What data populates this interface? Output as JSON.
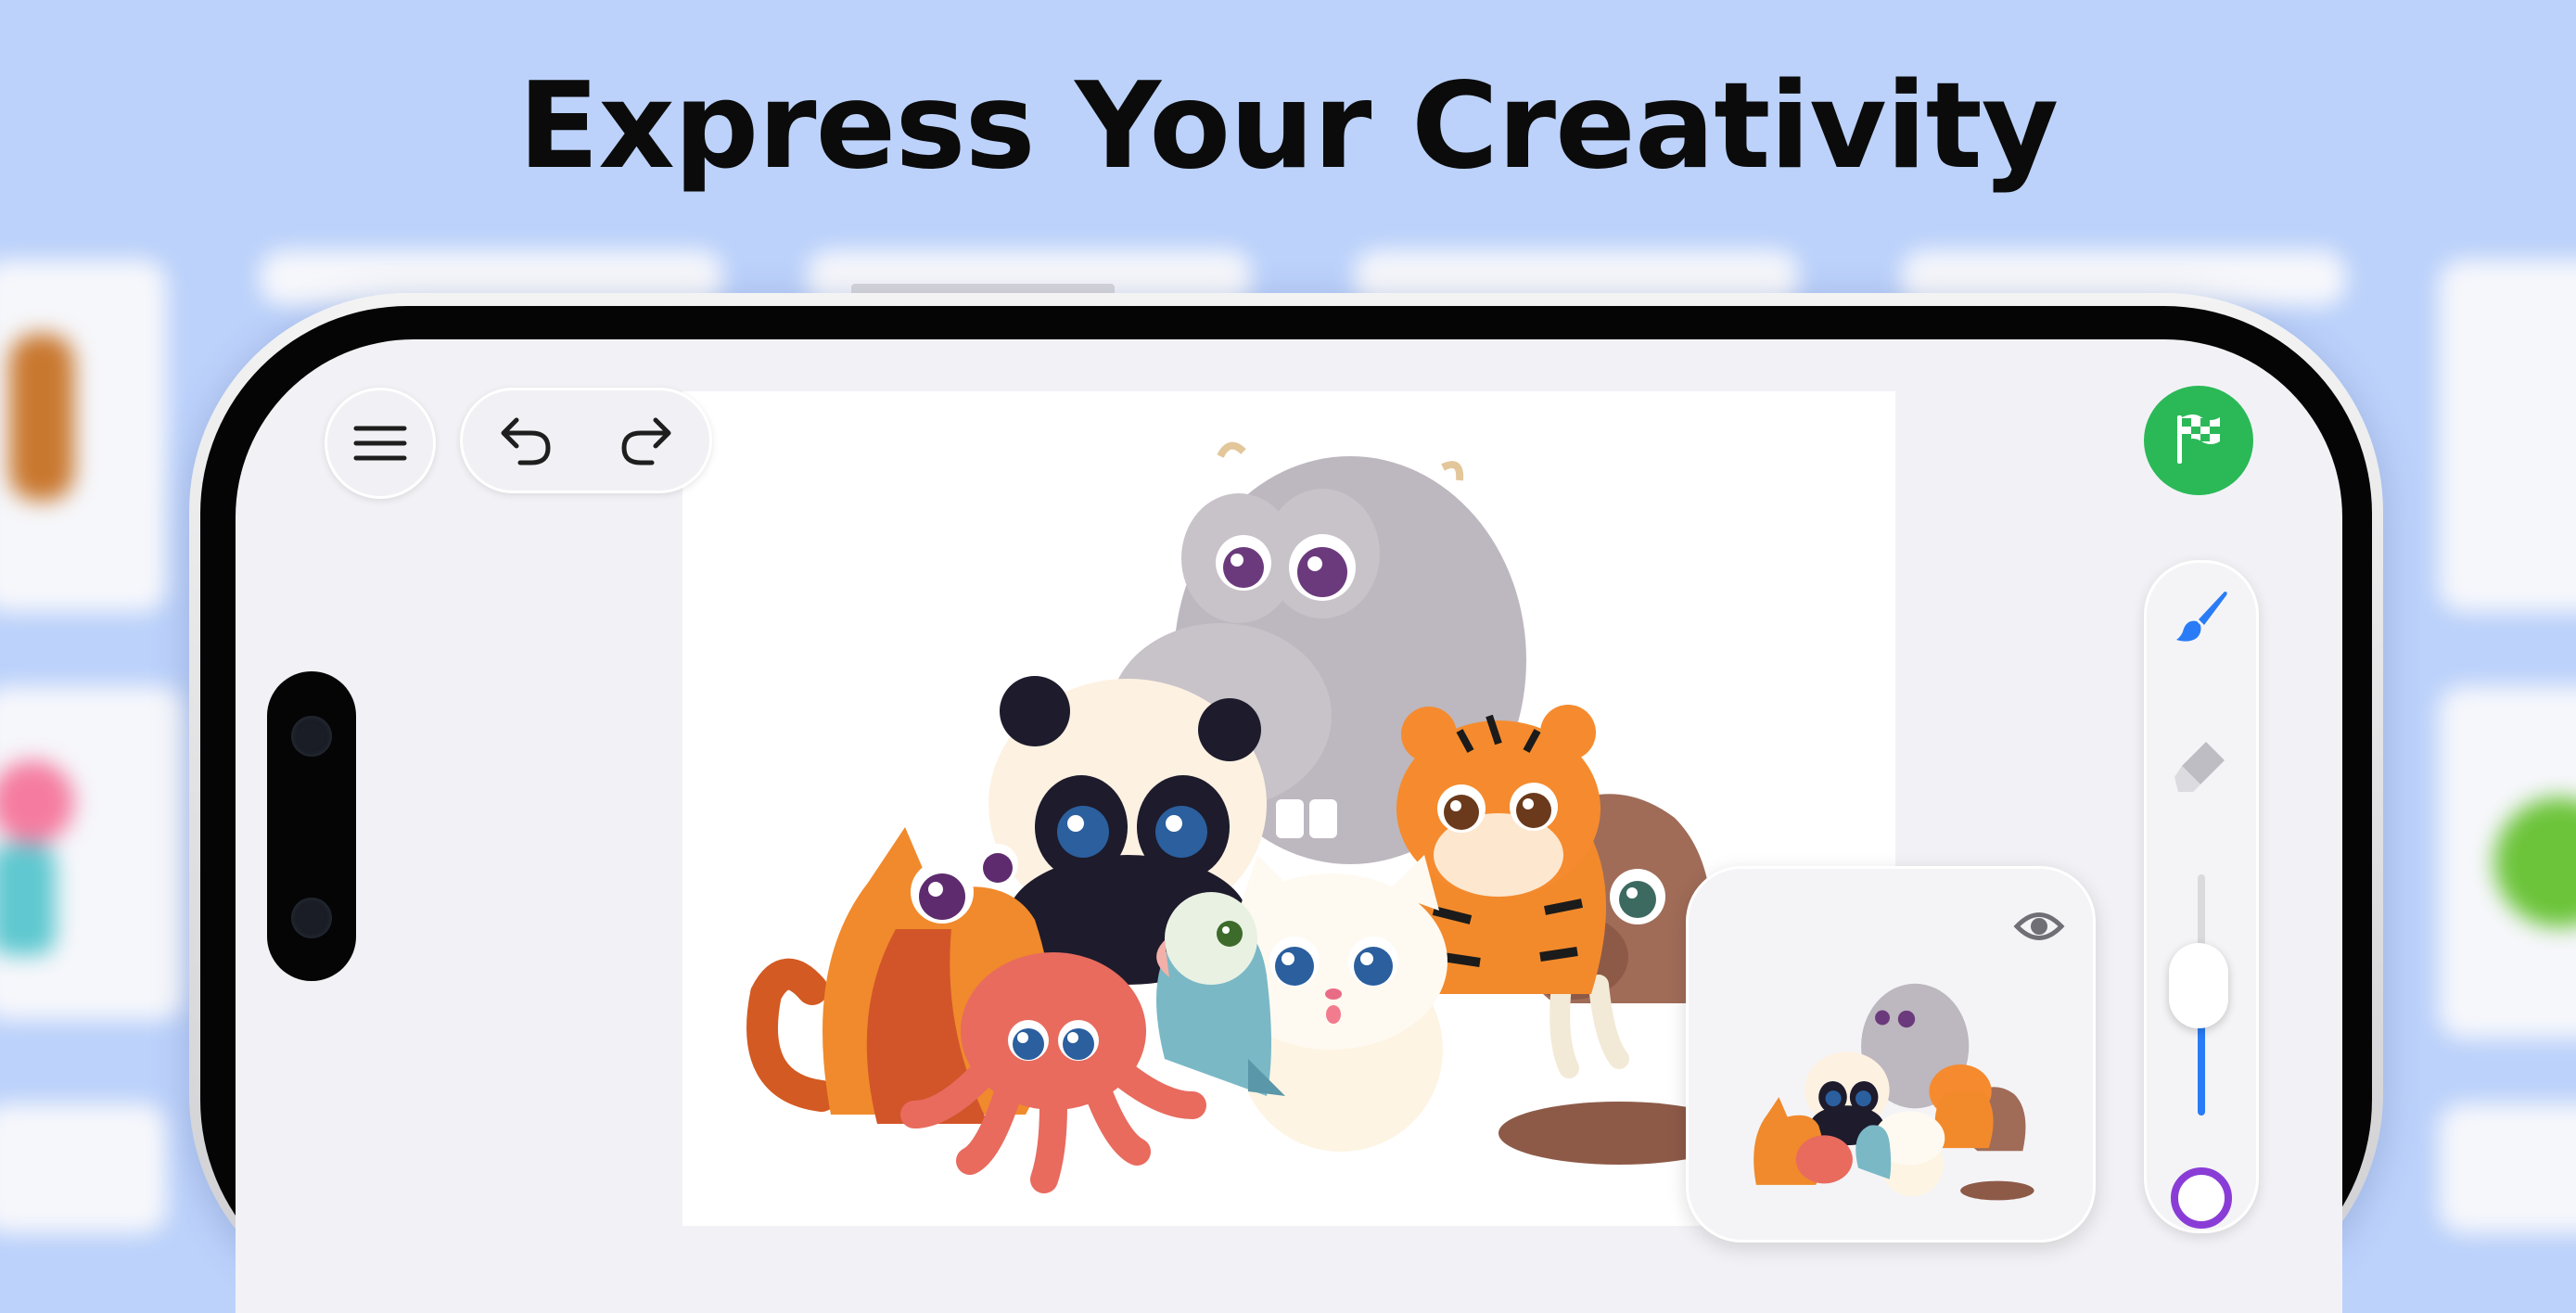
{
  "headline": "Express Your Creativity",
  "toolbar_top": {
    "menu_icon": "hamburger-menu-icon",
    "undo_icon": "undo-arrow-icon",
    "redo_icon": "redo-arrow-icon"
  },
  "finish": {
    "icon": "checkered-flag-icon",
    "color": "#2bb958"
  },
  "side_tools": {
    "brush_icon": "paintbrush-icon",
    "eraser_icon": "eraser-icon",
    "brush_size_fraction": 0.4,
    "accent": "#2a7cf6",
    "current_color": "#8a3dd6"
  },
  "preview": {
    "eye_icon": "eye-icon"
  },
  "artwork": {
    "characters": [
      "cat",
      "panda",
      "hippo",
      "tiger",
      "walrus",
      "octopus",
      "parrot",
      "white-kitten"
    ]
  }
}
